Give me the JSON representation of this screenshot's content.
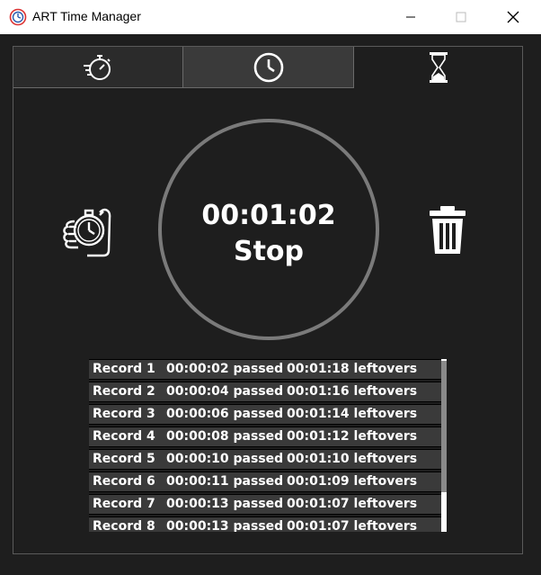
{
  "window": {
    "title": "ART Time Manager",
    "controls": [
      "minimize",
      "maximize",
      "close"
    ]
  },
  "tabs": [
    {
      "icon": "stopwatch-fast-icon",
      "active": false
    },
    {
      "icon": "clock-icon",
      "active": false
    },
    {
      "icon": "hourglass-icon",
      "active": true
    }
  ],
  "timer": {
    "display": "00:01:02",
    "state_label": "Stop"
  },
  "actions": {
    "lap_icon": "hand-stopwatch-icon",
    "clear_icon": "trash-icon"
  },
  "records": [
    {
      "name": "Record 1",
      "passed": "00:00:02 passed",
      "leftovers": "00:01:18 leftovers"
    },
    {
      "name": "Record 2",
      "passed": "00:00:04 passed",
      "leftovers": "00:01:16 leftovers"
    },
    {
      "name": "Record 3",
      "passed": "00:00:06 passed",
      "leftovers": "00:01:14 leftovers"
    },
    {
      "name": "Record 4",
      "passed": "00:00:08 passed",
      "leftovers": "00:01:12 leftovers"
    },
    {
      "name": "Record 5",
      "passed": "00:00:10 passed",
      "leftovers": "00:01:10 leftovers"
    },
    {
      "name": "Record 6",
      "passed": "00:00:11 passed",
      "leftovers": "00:01:09 leftovers"
    },
    {
      "name": "Record 7",
      "passed": "00:00:13 passed",
      "leftovers": "00:01:07 leftovers"
    },
    {
      "name": "Record 8",
      "passed": "00:00:13 passed",
      "leftovers": "00:01:07 leftovers"
    }
  ],
  "colors": {
    "background": "#1e1e1e",
    "ring": "#7a7a7a",
    "record_row": "#3a3a3a",
    "text": "#ffffff"
  }
}
